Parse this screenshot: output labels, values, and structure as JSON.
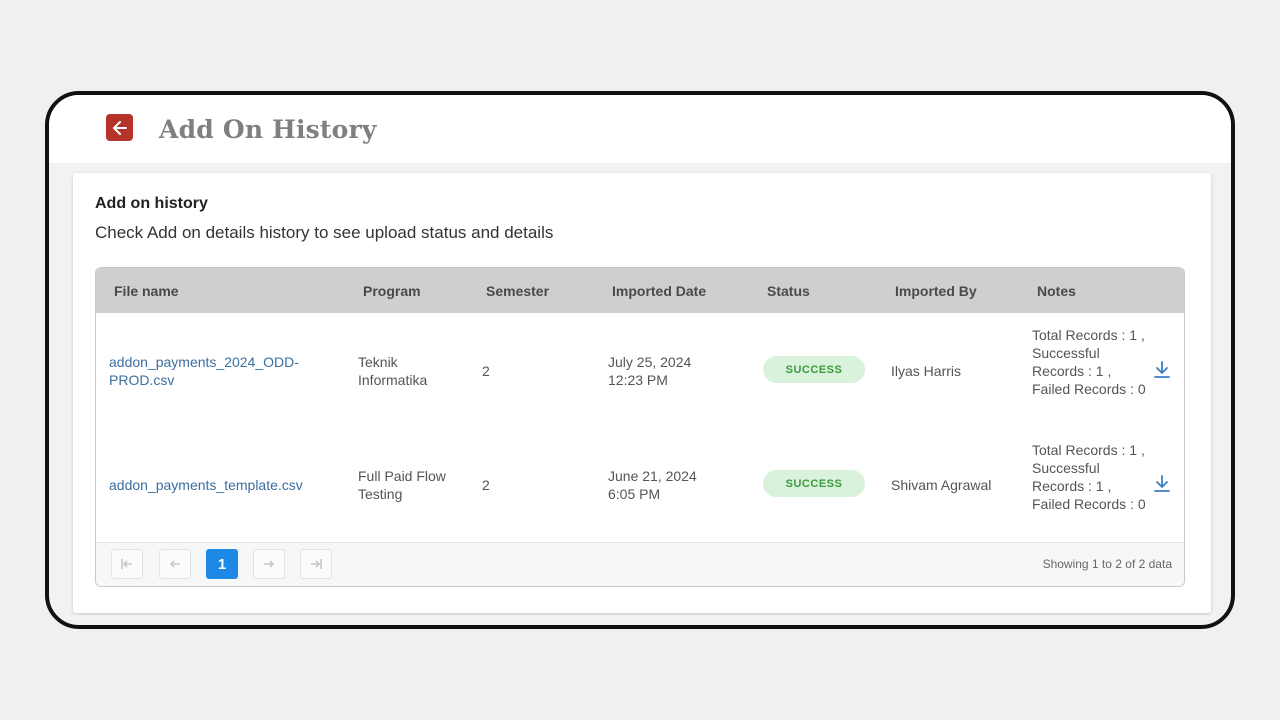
{
  "header": {
    "title": "Add On History",
    "back_icon": "arrow-left-icon",
    "accent": "#b5332a"
  },
  "card": {
    "title": "Add on history",
    "subtitle": "Check Add on details history to see upload status and details"
  },
  "table": {
    "columns": [
      "File name",
      "Program",
      "Semester",
      "Imported Date",
      "Status",
      "Imported By",
      "Notes"
    ],
    "rows": [
      {
        "file_name": "addon_payments_2024_ODD-PROD.csv",
        "program": "Teknik Informatika",
        "semester": "2",
        "date": "July 25, 2024",
        "time": "12:23 PM",
        "status": "SUCCESS",
        "imported_by": "Ilyas Harris",
        "notes": "Total Records : 1 , Successful Records : 1 , Failed Records : 0"
      },
      {
        "file_name": "addon_payments_template.csv",
        "program": "Full Paid Flow Testing",
        "semester": "2",
        "date": "June 21, 2024",
        "time": "6:05 PM",
        "status": "SUCCESS",
        "imported_by": "Shivam Agrawal",
        "notes": "Total Records : 1 , Successful Records : 1 , Failed Records : 0"
      }
    ]
  },
  "pagination": {
    "current_page": "1",
    "showing": "Showing 1 to 2 of 2 data",
    "active_color": "#1e88e5"
  },
  "status_colors": {
    "success_bg": "#d8f2dc",
    "success_text": "#3c9a3c"
  }
}
